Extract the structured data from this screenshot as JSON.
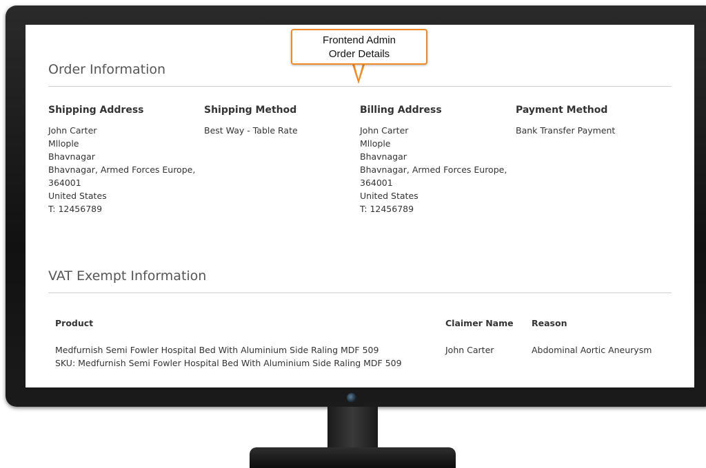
{
  "callout": {
    "line1": "Frontend Admin",
    "line2": "Order Details"
  },
  "order_info": {
    "title": "Order Information",
    "shipping_address": {
      "heading": "Shipping Address",
      "lines": [
        "John Carter",
        "Mllople",
        "Bhavnagar",
        "Bhavnagar, Armed Forces Europe,",
        "364001",
        "United States",
        "T: 12456789"
      ]
    },
    "shipping_method": {
      "heading": "Shipping Method",
      "value": "Best Way - Table Rate"
    },
    "billing_address": {
      "heading": "Billing Address",
      "lines": [
        "John Carter",
        "Mllople",
        "Bhavnagar",
        "Bhavnagar, Armed Forces Europe,",
        "364001",
        "United States",
        "T: 12456789"
      ]
    },
    "payment_method": {
      "heading": "Payment Method",
      "value": "Bank Transfer Payment"
    }
  },
  "vat": {
    "title": "VAT Exempt Information",
    "columns": {
      "product": "Product",
      "claimer": "Claimer Name",
      "reason": "Reason"
    },
    "rows": [
      {
        "product_name": "Medfurnish Semi Fowler Hospital Bed With Aluminium Side Raling MDF 509",
        "sku": "SKU: Medfurnish Semi Fowler Hospital Bed With Aluminium Side Raling MDF 509",
        "claimer": "John Carter",
        "reason": "Abdominal Aortic Aneurysm"
      }
    ]
  }
}
